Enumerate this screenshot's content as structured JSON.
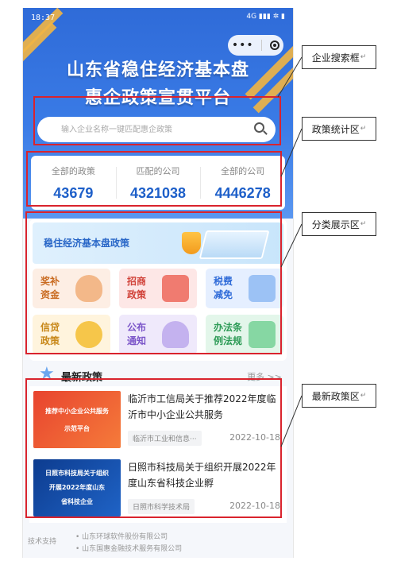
{
  "status_bar": {
    "time": "18:37",
    "right": "4G ▮▮▮ ✲ ▮"
  },
  "header": {
    "title_line1": "山东省稳住经济基本盘",
    "title_line2": "惠企政策宣贯平台"
  },
  "search": {
    "placeholder": "输入企业名称一键匹配惠企政策"
  },
  "stats": [
    {
      "label": "全部的政策",
      "value": "43679"
    },
    {
      "label": "匹配的公司",
      "value": "4321038"
    },
    {
      "label": "全部的公司",
      "value": "4446278"
    }
  ],
  "category": {
    "banner_title": "稳住经济基本盘政策",
    "tiles": [
      {
        "line1": "奖补",
        "line2": "资金"
      },
      {
        "line1": "招商",
        "line2": "政策"
      },
      {
        "line1": "税费",
        "line2": "减免"
      },
      {
        "line1": "信贷",
        "line2": "政策"
      },
      {
        "line1": "公布",
        "line2": "通知"
      },
      {
        "line1": "办法条",
        "line2": "例法规"
      }
    ]
  },
  "latest": {
    "title": "最新政策",
    "more": "更多 >>",
    "items": [
      {
        "title": "临沂市工信局关于推荐2022年度临沂市中小企业公共服务",
        "tag": "临沂市工业和信息···",
        "date": "2022-10-18",
        "thumb_line1": "推荐中小企业公共服务",
        "thumb_line2": "示范平台"
      },
      {
        "title": "日照市科技局关于组织开展2022年度山东省科技企业孵",
        "tag": "日照市科学技术局",
        "date": "2022-10-18",
        "thumb_line1": "日照市科技局关于组织",
        "thumb_line2": "开展2022年度山东",
        "thumb_line3": "省科技企业"
      }
    ]
  },
  "footer": {
    "label": "技术支持",
    "companies": [
      "• 山东环球软件股份有限公司",
      "• 山东国惠金融技术服务有限公司"
    ]
  },
  "callouts": {
    "search": "企业搜索框",
    "stats": "政策统计区",
    "category": "分类展示区",
    "latest": "最新政策区",
    "return_mark": "↵"
  }
}
